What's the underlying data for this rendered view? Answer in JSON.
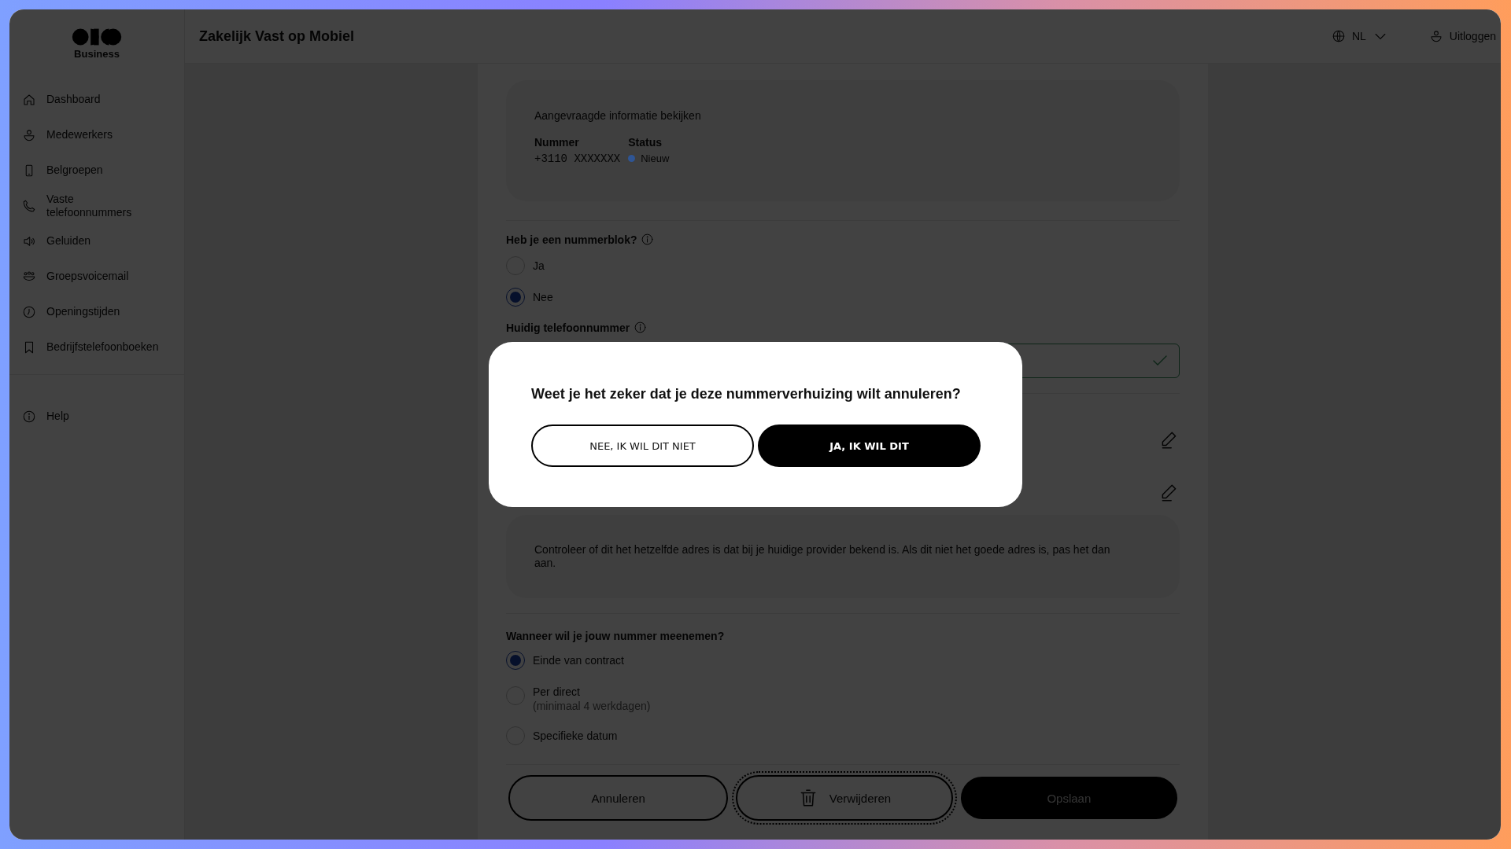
{
  "sidebar": {
    "brand": "Business",
    "items": [
      {
        "label": "Dashboard"
      },
      {
        "label": "Medewerkers"
      },
      {
        "label": "Belgroepen"
      },
      {
        "label": "Vaste telefoonnummers"
      },
      {
        "label": "Geluiden"
      },
      {
        "label": "Groepsvoicemail"
      },
      {
        "label": "Openingstijden"
      },
      {
        "label": "Bedrijfstelefoonboeken"
      }
    ],
    "footer_items": [
      {
        "label": "Help"
      }
    ]
  },
  "header": {
    "title": "Zakelijk Vast op Mobiel",
    "language": "NL",
    "logout": "Uitloggen"
  },
  "request_card": {
    "title": "Aangevraagde informatie bekijken",
    "columns": [
      {
        "heading": "Nummer",
        "value": "+3110 XXXXXXX"
      },
      {
        "heading": "Status",
        "value": "Nieuw",
        "color": "#2f5594"
      }
    ]
  },
  "number_block": {
    "question": "Heb je een nummerblok?",
    "options": [
      {
        "label": "Ja",
        "selected": false
      },
      {
        "label": "Nee",
        "selected": true
      }
    ]
  },
  "current_number": {
    "label": "Huidig telefoonnummer",
    "valid": true
  },
  "address_note": "Controleer of dit het hetzelfde adres is dat bij je huidige provider bekend is. Als dit niet het goede adres is, pas het dan aan.",
  "transfer_moment": {
    "question": "Wanneer wil je jouw nummer meenemen?",
    "options": [
      {
        "label": "Einde van contract",
        "selected": true
      },
      {
        "label": "Per direct",
        "hint": "(minimaal 4 werkdagen)",
        "selected": false
      },
      {
        "label": "Specifieke datum",
        "selected": false
      }
    ]
  },
  "actions": [
    {
      "label": "Annuleren",
      "kind": "outline",
      "focused": false,
      "disabled": false
    },
    {
      "label": "Verwijderen",
      "kind": "delete",
      "focused": true,
      "disabled": false
    },
    {
      "label": "Opslaan",
      "kind": "primary",
      "focused": false,
      "disabled": true
    }
  ],
  "dialog": {
    "title": "Weet je het zeker dat je deze nummerverhuizing wilt annuleren?",
    "buttons": [
      {
        "label": "NEE, IK WIL DIT NIET",
        "kind": "outline"
      },
      {
        "label": "JA, IK WIL DIT",
        "kind": "primary"
      }
    ]
  }
}
